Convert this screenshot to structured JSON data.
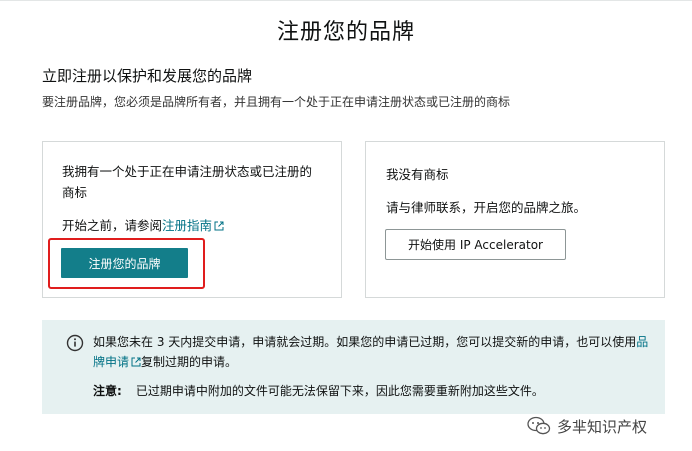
{
  "page": {
    "title": "注册您的品牌",
    "heading": "立即注册以保护和发展您的品牌",
    "description": "要注册品牌，您必须是品牌所有者，并且拥有一个处于正在申请注册状态或已注册的商标"
  },
  "left_card": {
    "title": "我拥有一个处于正在申请注册状态或已注册的商标",
    "hint_prefix": "开始之前，请参阅",
    "hint_link": "注册指南",
    "button": "注册您的品牌"
  },
  "right_card": {
    "title": "我没有商标",
    "description": "请与律师联系，开启您的品牌之旅。",
    "button": "开始使用 IP Accelerator"
  },
  "notice": {
    "text_part1": "如果您未在 3 天内提交申请，申请就会过期。如果您的申请已过期，您可以提交新的申请，也可以使用",
    "link": "品牌申请",
    "text_part2": "复制过期的申请。",
    "note_label": "注意:",
    "note_text": "已过期申请中附加的文件可能无法保留下来，因此您需要重新附加这些文件。"
  },
  "watermark": {
    "text": "多芈知识产权"
  },
  "colors": {
    "primary_button": "#137e8a",
    "link": "#007185",
    "highlight": "#e01d1d",
    "info_background": "#e6f1f1"
  },
  "icons": {
    "external_link": "external-link-icon",
    "info": "info-icon",
    "watermark": "wechat-logo-icon"
  }
}
